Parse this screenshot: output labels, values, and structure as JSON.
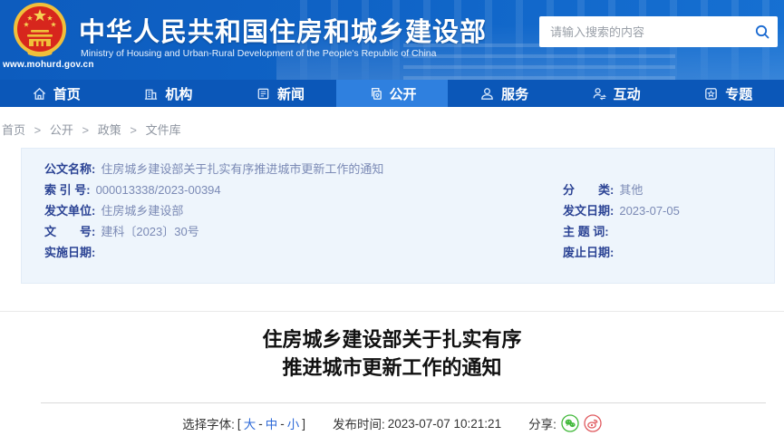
{
  "header": {
    "site_url": "www.mohurd.gov.cn",
    "title": "中华人民共和国住房和城乡建设部",
    "subtitle": "Ministry of Housing and Urban-Rural Development of the People's Republic of China",
    "search": {
      "placeholder": "请输入搜索的内容"
    }
  },
  "nav": {
    "items": [
      {
        "label": "首页",
        "icon": "home-icon",
        "active": false
      },
      {
        "label": "机构",
        "icon": "building-icon",
        "active": false
      },
      {
        "label": "新闻",
        "icon": "news-icon",
        "active": false
      },
      {
        "label": "公开",
        "icon": "disclosure-icon",
        "active": true
      },
      {
        "label": "服务",
        "icon": "service-icon",
        "active": false
      },
      {
        "label": "互动",
        "icon": "interact-icon",
        "active": false
      },
      {
        "label": "专题",
        "icon": "topics-icon",
        "active": false
      }
    ]
  },
  "breadcrumb": {
    "separator": ">",
    "items": [
      "首页",
      "公开",
      "政策",
      "文件库"
    ]
  },
  "doc_meta": {
    "left": [
      {
        "label": "公文名称:",
        "value": "住房城乡建设部关于扎实有序推进城市更新工作的通知"
      },
      {
        "label": "索 引 号:",
        "value": "000013338/2023-00394"
      },
      {
        "label": "发文单位:",
        "value": "住房城乡建设部"
      },
      {
        "label": "文　　号:",
        "value": "建科〔2023〕30号"
      },
      {
        "label": "实施日期:",
        "value": ""
      }
    ],
    "right": [
      {
        "label": "分　　类:",
        "value": "其他"
      },
      {
        "label": "发文日期:",
        "value": "2023-07-05"
      },
      {
        "label": "主 题 词:",
        "value": ""
      },
      {
        "label": "废止日期:",
        "value": ""
      }
    ]
  },
  "article": {
    "title_line1": "住房城乡建设部关于扎实有序",
    "title_line2": "推进城市更新工作的通知",
    "toolbar": {
      "font_label": "选择字体:",
      "bracket_open": "[",
      "font_large": "大",
      "dash": "-",
      "font_medium": "中",
      "font_small": "小",
      "bracket_close": "]",
      "publish_label": "发布时间:",
      "publish_time": "2023-07-07 10:21:21",
      "share_label": "分享:",
      "share_icons": [
        "wechat-share-icon",
        "weibo-share-icon"
      ]
    }
  },
  "colors": {
    "header_bg": "#0f63c6",
    "nav_bg": "#0b57b8",
    "nav_active_bg": "#2f80df",
    "panel_bg": "#eef5fc",
    "meta_label": "#2b4394",
    "meta_value": "#7b8ab5",
    "link_blue": "#2f6bd8",
    "wechat_green": "#43b93c",
    "weibo_red": "#e05a5f",
    "emblem_red": "#d7261d",
    "emblem_gold": "#f0bf3a"
  }
}
